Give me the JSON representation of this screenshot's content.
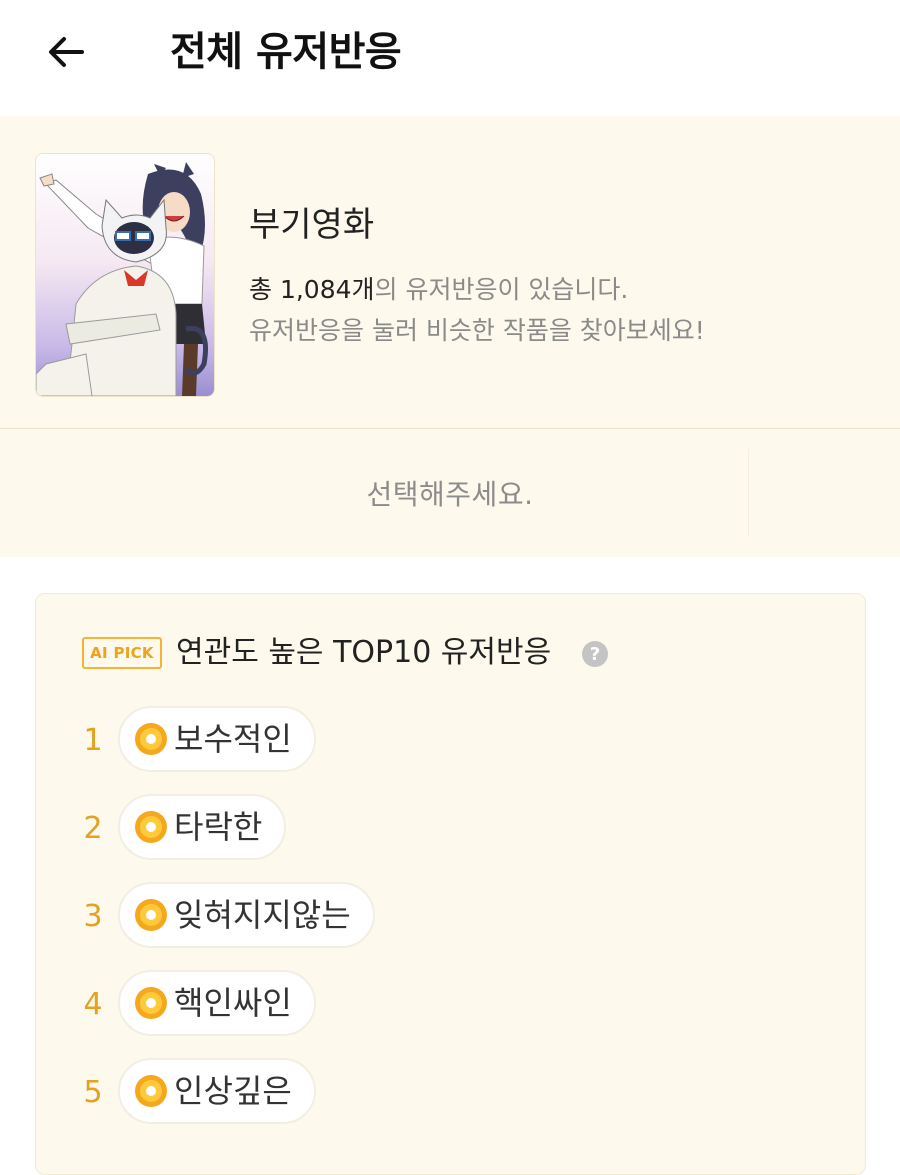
{
  "header": {
    "title": "전체 유저반응",
    "back_icon": "arrow-left-icon"
  },
  "work": {
    "title": "부기영화",
    "count_prefix": "총 ",
    "count_value": "1,084개",
    "count_suffix": "의 유저반응이 있습니다.",
    "hint": "유저반응을 눌러 비슷한 작품을 찾아보세요!"
  },
  "filter": {
    "placeholder": "선택해주세요."
  },
  "top10": {
    "badge": "AI PICK",
    "title": "연관도 높은 TOP10 유저반응",
    "help": "?",
    "items": [
      {
        "rank": "1",
        "label": "보수적인"
      },
      {
        "rank": "2",
        "label": "타락한"
      },
      {
        "rank": "3",
        "label": "잊혀지지않는"
      },
      {
        "rank": "4",
        "label": "핵인싸인"
      },
      {
        "rank": "5",
        "label": "인상깊은"
      }
    ]
  },
  "colors": {
    "panel_background": "#fdf9ec",
    "accent_orange": "#f0a21a",
    "rank_number": "#e3a21f",
    "muted_text": "#8a8a8a"
  }
}
